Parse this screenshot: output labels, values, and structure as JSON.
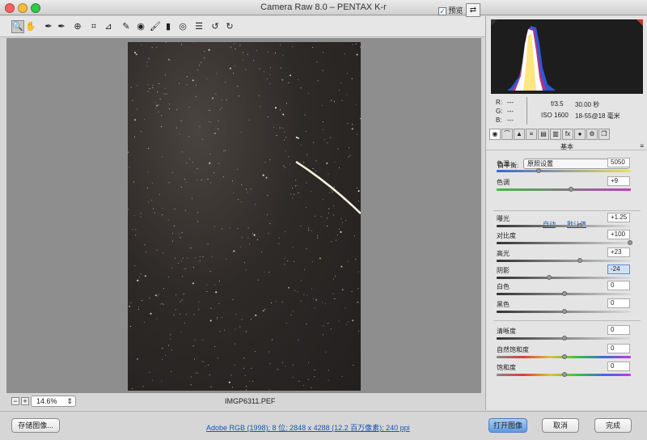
{
  "window": {
    "title": "Camera Raw 8.0 –  PENTAX K-r"
  },
  "toolbar": {
    "tools": [
      {
        "name": "zoom-tool-icon",
        "glyph": "🔍"
      },
      {
        "name": "hand-tool-icon",
        "glyph": "✋"
      },
      {
        "name": "white-balance-tool-icon",
        "glyph": "✒"
      },
      {
        "name": "color-sampler-tool-icon",
        "glyph": "✒"
      },
      {
        "name": "targeted-adjustment-tool-icon",
        "glyph": "⊕"
      },
      {
        "name": "crop-tool-icon",
        "glyph": "⌗"
      },
      {
        "name": "straighten-tool-icon",
        "glyph": "⊿"
      },
      {
        "name": "spot-removal-tool-icon",
        "glyph": "✎"
      },
      {
        "name": "red-eye-tool-icon",
        "glyph": "◉"
      },
      {
        "name": "adjustment-brush-icon",
        "glyph": "🖌"
      },
      {
        "name": "graduated-filter-icon",
        "glyph": "▮"
      },
      {
        "name": "radial-filter-icon",
        "glyph": "◎"
      },
      {
        "name": "preferences-icon",
        "glyph": "☰"
      },
      {
        "name": "rotate-left-icon",
        "glyph": "↺"
      },
      {
        "name": "rotate-right-icon",
        "glyph": "↻"
      }
    ],
    "preview_label": "预览",
    "preview_checked": "✓"
  },
  "status": {
    "zoom": "14.6%",
    "filename": "IMGP6311.PEF"
  },
  "readout": {
    "r_label": "R:",
    "g_label": "G:",
    "b_label": "B:",
    "rgb_dashes": "---",
    "aperture": "f/3.5",
    "shutter": "30.00 秒",
    "iso": "ISO 1600",
    "lens": "18-55@18 毫米"
  },
  "panel": {
    "section_title": "基本",
    "white_balance_label": "白平衡:",
    "white_balance_value": "原照设置",
    "auto_link": "自动",
    "default_link": "默认值",
    "sliders": [
      {
        "name": "temperature",
        "label": "色温",
        "value": "5050",
        "level": 0.3
      },
      {
        "name": "tint",
        "label": "色调",
        "value": "+9",
        "level": 0.55
      },
      {
        "name": "exposure",
        "label": "曝光",
        "value": "+1.25",
        "level": 0.62
      },
      {
        "name": "contrast",
        "label": "对比度",
        "value": "+100",
        "level": 1.0
      },
      {
        "name": "highlights",
        "label": "高光",
        "value": "+23",
        "level": 0.62
      },
      {
        "name": "shadows",
        "label": "阴影",
        "value": "-24",
        "level": 0.38
      },
      {
        "name": "whites",
        "label": "白色",
        "value": "0",
        "level": 0.5
      },
      {
        "name": "blacks",
        "label": "黑色",
        "value": "0",
        "level": 0.5
      },
      {
        "name": "clarity",
        "label": "清晰度",
        "value": "0",
        "level": 0.5
      },
      {
        "name": "vibrance",
        "label": "自然饱和度",
        "value": "0",
        "level": 0.5
      },
      {
        "name": "saturation",
        "label": "饱和度",
        "value": "0",
        "level": 0.5
      }
    ]
  },
  "bottom": {
    "save_label": "存储图像...",
    "workflow_link": "Adobe RGB (1998); 8 位; 2848 x 4288 (12.2 百万像素); 240 ppi",
    "open_label": "打开图像",
    "cancel_label": "取消",
    "done_label": "完成"
  },
  "colors": {
    "accent": "#5f9ae0",
    "link": "#1a56b0",
    "highlight_field": "#cfe0f7"
  }
}
